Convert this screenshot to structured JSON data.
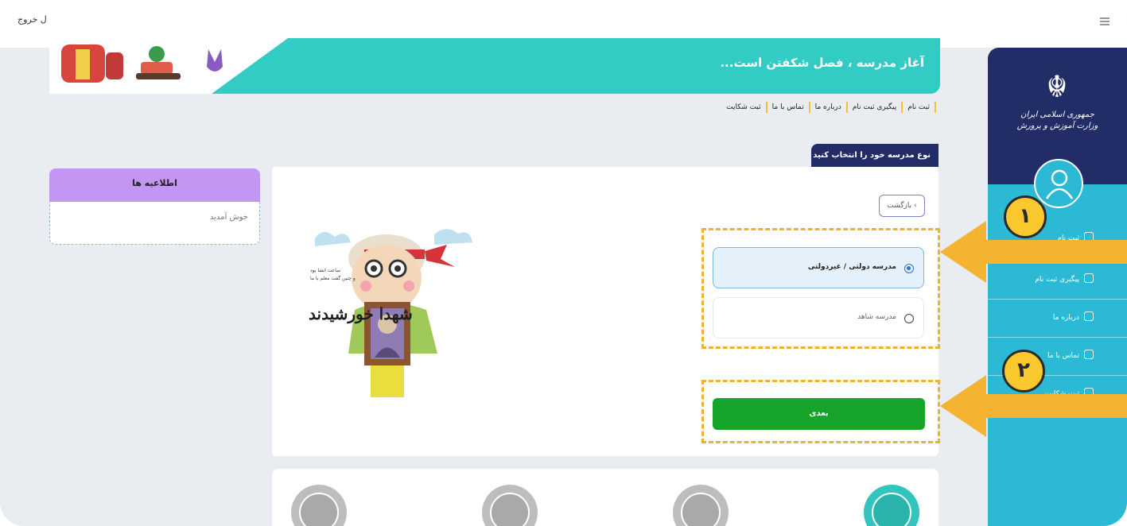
{
  "topbar": {
    "logout_label": "خروج"
  },
  "banner": {
    "title": "آغاز مدرسه ، فصل شکفتن است..."
  },
  "sidebar": {
    "ministry_line1": "جمهوری اسلامی ایران",
    "ministry_line2": "وزارت آموزش و پرورش",
    "items": [
      {
        "label": "ثبت نام"
      },
      {
        "label": "پیگیری ثبت نام"
      },
      {
        "label": "درباره ما"
      },
      {
        "label": "تماس با ما"
      },
      {
        "label": "ثبت شکایت"
      }
    ]
  },
  "links": [
    "ثبت نام",
    "پیگیری ثبت نام",
    "درباره ما",
    "تماس با ما",
    "ثبت شکایت"
  ],
  "section": {
    "title": "نوع مدرسه خود را انتخاب کنید"
  },
  "form": {
    "back_label": "بازگشت",
    "options": [
      {
        "label": "مدرسه دولتی / غیردولتی",
        "selected": true
      },
      {
        "label": "مدرسه شاهد",
        "selected": false
      }
    ],
    "next_label": "بعدی"
  },
  "illustration": {
    "caption_small_1": "ساعت انشا بود",
    "caption_small_2": "و چنین گفت معلم با ما",
    "caption_big": "شهدا خورشیدند"
  },
  "notice": {
    "title": "اطلاعیه ها",
    "message": "خوش آمدید"
  },
  "annotations": {
    "marker_1": "۱",
    "marker_2": "۲"
  },
  "colors": {
    "accent_navy": "#222d68",
    "accent_teal": "#32ccc5",
    "next_green": "#16a52a",
    "highlight_orange": "#efb22f",
    "notice_purple": "#c496f4"
  }
}
